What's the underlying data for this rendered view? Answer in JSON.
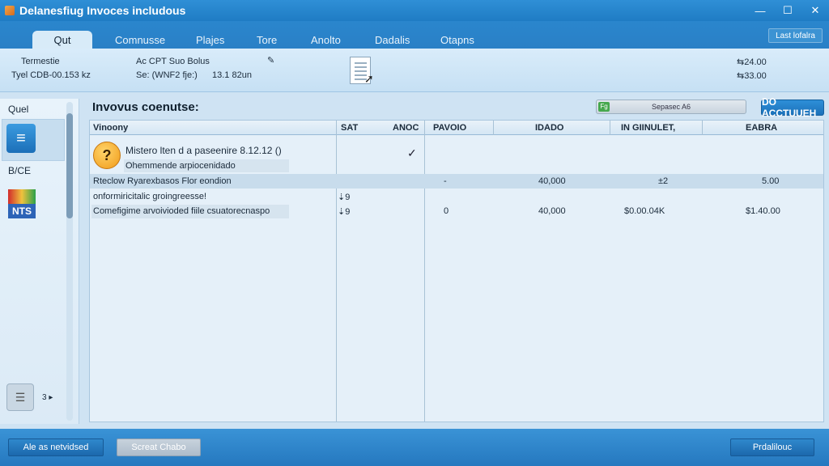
{
  "window": {
    "title": "Delanesfiug Invoces includous",
    "minimize": "—",
    "maximize": "☐",
    "close": "✕"
  },
  "tabs": [
    {
      "label": "Qut",
      "active": true
    },
    {
      "label": "Comnusse"
    },
    {
      "label": "Plajes"
    },
    {
      "label": "Tore"
    },
    {
      "label": "Anolto"
    },
    {
      "label": "Dadalis"
    },
    {
      "label": "Otapns"
    }
  ],
  "tab_right_button": "Last lofalra",
  "info": {
    "line1_left": "Termestie",
    "line2_left": "Tyel CDB-00.153 kz",
    "line1_mid": "Ac CPT Suo Bolus",
    "line2_mid": "Se: (WNF2 fje:)",
    "line2_mid2": "13.1 82un",
    "pin": "✎",
    "line1_right": "⇆24.00",
    "line2_right": "⇆33.00"
  },
  "sidebar": {
    "top_label": "Quel",
    "section_label": "B/CE",
    "nts_label": "NTS",
    "page_indicator": "3 ▸"
  },
  "main": {
    "heading": "Invovus coenutse:",
    "search_placeholder": "Sepasec A6",
    "search_tag": "Fg",
    "primary_button": "DO ACCTUUEH"
  },
  "table": {
    "headers": [
      "Vinoony",
      "SAT",
      "ANOC",
      "PAVOIO",
      "IDADO",
      "IN GIINULET,",
      "EABRA"
    ],
    "rows": [
      {
        "title": "Mistero lten d a paseenire 8.12.12 ()",
        "subtitle": "Ohemmende arpiocenidado",
        "checked": "✓"
      },
      {
        "title": "Rteclow Ryarexbasos Flor eondion",
        "col_pavoio": "-",
        "col_idado": "40,000",
        "col_ingiinulet": "±2",
        "col_eabra": "5.00"
      },
      {
        "title": "onformiricitalic groingreesse!",
        "col_sat": "⇣9"
      },
      {
        "title": "Comefigime arvoivioded fiile csuatorecnaspo",
        "col_sat": "⇣9",
        "col_pavoio": "0",
        "col_idado": "40,000",
        "col_ingiinulet": "$0.00.04K",
        "col_eabra": "$1.40.00"
      }
    ]
  },
  "footer": {
    "left_button": "Ale as netvidsed",
    "mid_button": "Screat Chabo",
    "right_button": "Prdalilouc"
  },
  "colors": {
    "titlebar": "#1f7cc4",
    "accent": "#2e8fd8",
    "selected_row": "#c8dcec"
  }
}
